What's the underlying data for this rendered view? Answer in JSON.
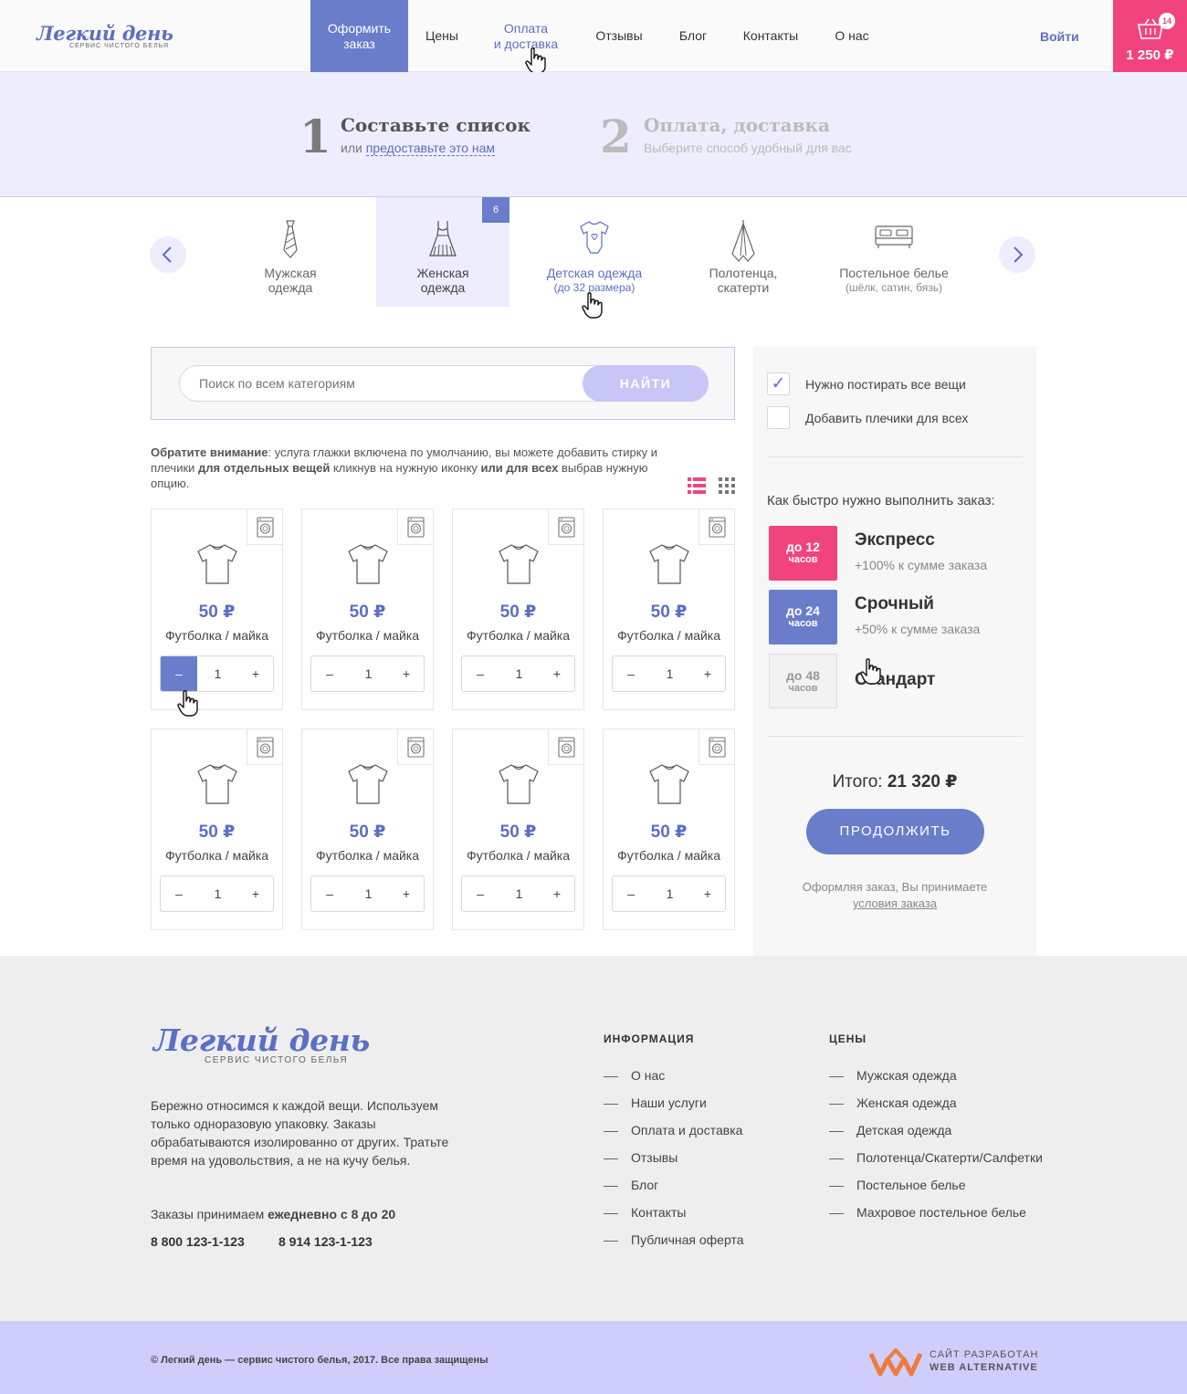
{
  "header": {
    "logo_main": "Легкий день",
    "logo_sub": "сервис чистого белья",
    "nav": {
      "order_line1": "Оформить",
      "order_line2": "заказ",
      "prices": "Цены",
      "payment_line1": "Оплата",
      "payment_line2": "и доставка",
      "reviews": "Отзывы",
      "blog": "Блог",
      "contacts": "Контакты",
      "about": "О нас"
    },
    "login": "Войти",
    "cart_count": "14",
    "cart_total": "1 250 ₽"
  },
  "steps": {
    "step1_num": "1",
    "step1_title": "Составьте список",
    "step1_or": "или",
    "step1_link": "предоставьте это нам",
    "step2_num": "2",
    "step2_title": "Оплата, доставка",
    "step2_sub": "Выберите способ удобный для вас"
  },
  "categories": [
    {
      "icon": "tie-icon",
      "line1": "Мужская",
      "line2": "одежда"
    },
    {
      "icon": "dress-icon",
      "line1": "Женская",
      "line2": "одежда",
      "badge": "6"
    },
    {
      "icon": "bodysuit-icon",
      "line1": "Детская одежда",
      "line2": "(до 32 размера)"
    },
    {
      "icon": "towel-icon",
      "line1": "Полотенца,",
      "line2": "скатерти"
    },
    {
      "icon": "bed-icon",
      "line1": "Постельное белье",
      "line2": "(шёлк, сатин, бязь)"
    }
  ],
  "search": {
    "placeholder": "Поиск по всем категориям",
    "button": "НАЙТИ"
  },
  "notice": {
    "bold1": "Обратите внимание",
    "text1": ": услуга глажки включена по умолчанию, вы можете добавить стирку и плечики ",
    "bold2": "для отдельных вещей",
    "text2": " кликнув на нужную иконку ",
    "bold3": "или для всех",
    "text3": " выбрав нужную опцию."
  },
  "products": [
    {
      "price": "50 ₽",
      "name": "Футболка / майка",
      "qty": "1",
      "minus": "–",
      "plus": "+"
    },
    {
      "price": "50 ₽",
      "name": "Футболка / майка",
      "qty": "1",
      "minus": "–",
      "plus": "+"
    },
    {
      "price": "50 ₽",
      "name": "Футболка / майка",
      "qty": "1",
      "minus": "–",
      "plus": "+"
    },
    {
      "price": "50 ₽",
      "name": "Футболка / майка",
      "qty": "1",
      "minus": "–",
      "plus": "+"
    },
    {
      "price": "50 ₽",
      "name": "Футболка / майка",
      "qty": "1",
      "minus": "–",
      "plus": "+"
    },
    {
      "price": "50 ₽",
      "name": "Футболка / майка",
      "qty": "1",
      "minus": "–",
      "plus": "+"
    },
    {
      "price": "50 ₽",
      "name": "Футболка / майка",
      "qty": "1",
      "minus": "–",
      "plus": "+"
    },
    {
      "price": "50 ₽",
      "name": "Футболка / майка",
      "qty": "1",
      "minus": "–",
      "plus": "+"
    }
  ],
  "options": {
    "iron_all": "Нужно постирать все вещи",
    "iron_all_checked": true,
    "hangers_all": "Добавить плечики для всех",
    "hangers_all_checked": false,
    "speed_question": "Как быстро нужно выполнить заказ:",
    "speeds": [
      {
        "box_top": "до 12",
        "box_bottom": "часов",
        "title": "Экспресс",
        "sub": "+100% к сумме заказа",
        "color": "#f2447c"
      },
      {
        "box_top": "до 24",
        "box_bottom": "часов",
        "title": "Срочный",
        "sub": "+50% к сумме заказа",
        "color": "#6a7dcb"
      },
      {
        "box_top": "до 48",
        "box_bottom": "часов",
        "title": "Стандарт",
        "sub": "",
        "color": "#f2f2f2"
      }
    ]
  },
  "summary": {
    "total_label": "Итого:",
    "total_value": "21 320 ₽",
    "continue": "ПРОДОЛЖИТЬ",
    "terms_text": "Оформляя заказ, Вы принимаете",
    "terms_link": "условия заказа"
  },
  "footer": {
    "logo_main": "Легкий день",
    "logo_sub": "сервис чистого белья",
    "description": "Бережно относимся к каждой вещи. Используем только одноразовую упаковку.  Заказы обрабатываются изолированно от других. Тратьте время на удовольствия, а не на кучу белья.",
    "hours_prefix": "Заказы  принимаем ",
    "hours_bold": "ежедневно с 8 до 20",
    "phone1": "8 800 123-1-123",
    "phone2": "8 914  123-1-123",
    "info_title": "ИНФОРМАЦИЯ",
    "info_links": [
      "О нас",
      "Наши услуги",
      "Оплата и доставка",
      "Отзывы",
      "Блог",
      "Контакты",
      "Публичная оферта"
    ],
    "prices_title": "ЦЕНЫ",
    "price_links": [
      "Мужская одежда",
      "Женская одежда",
      "Детская одежда",
      "Полотенца/Скатерти/Салфетки",
      "Постельное белье",
      "Махровое постельное белье"
    ],
    "copyright": "© Легкий день — сервис чистого белья, 2017. Все права защищены",
    "dev_line1": "САЙТ РАЗРАБОТАН",
    "dev_line2": "WEB ALTERNATIVE"
  },
  "colors": {
    "accent": "#6a7dcb",
    "pink": "#f2447c",
    "lavender": "#eeedfd"
  }
}
